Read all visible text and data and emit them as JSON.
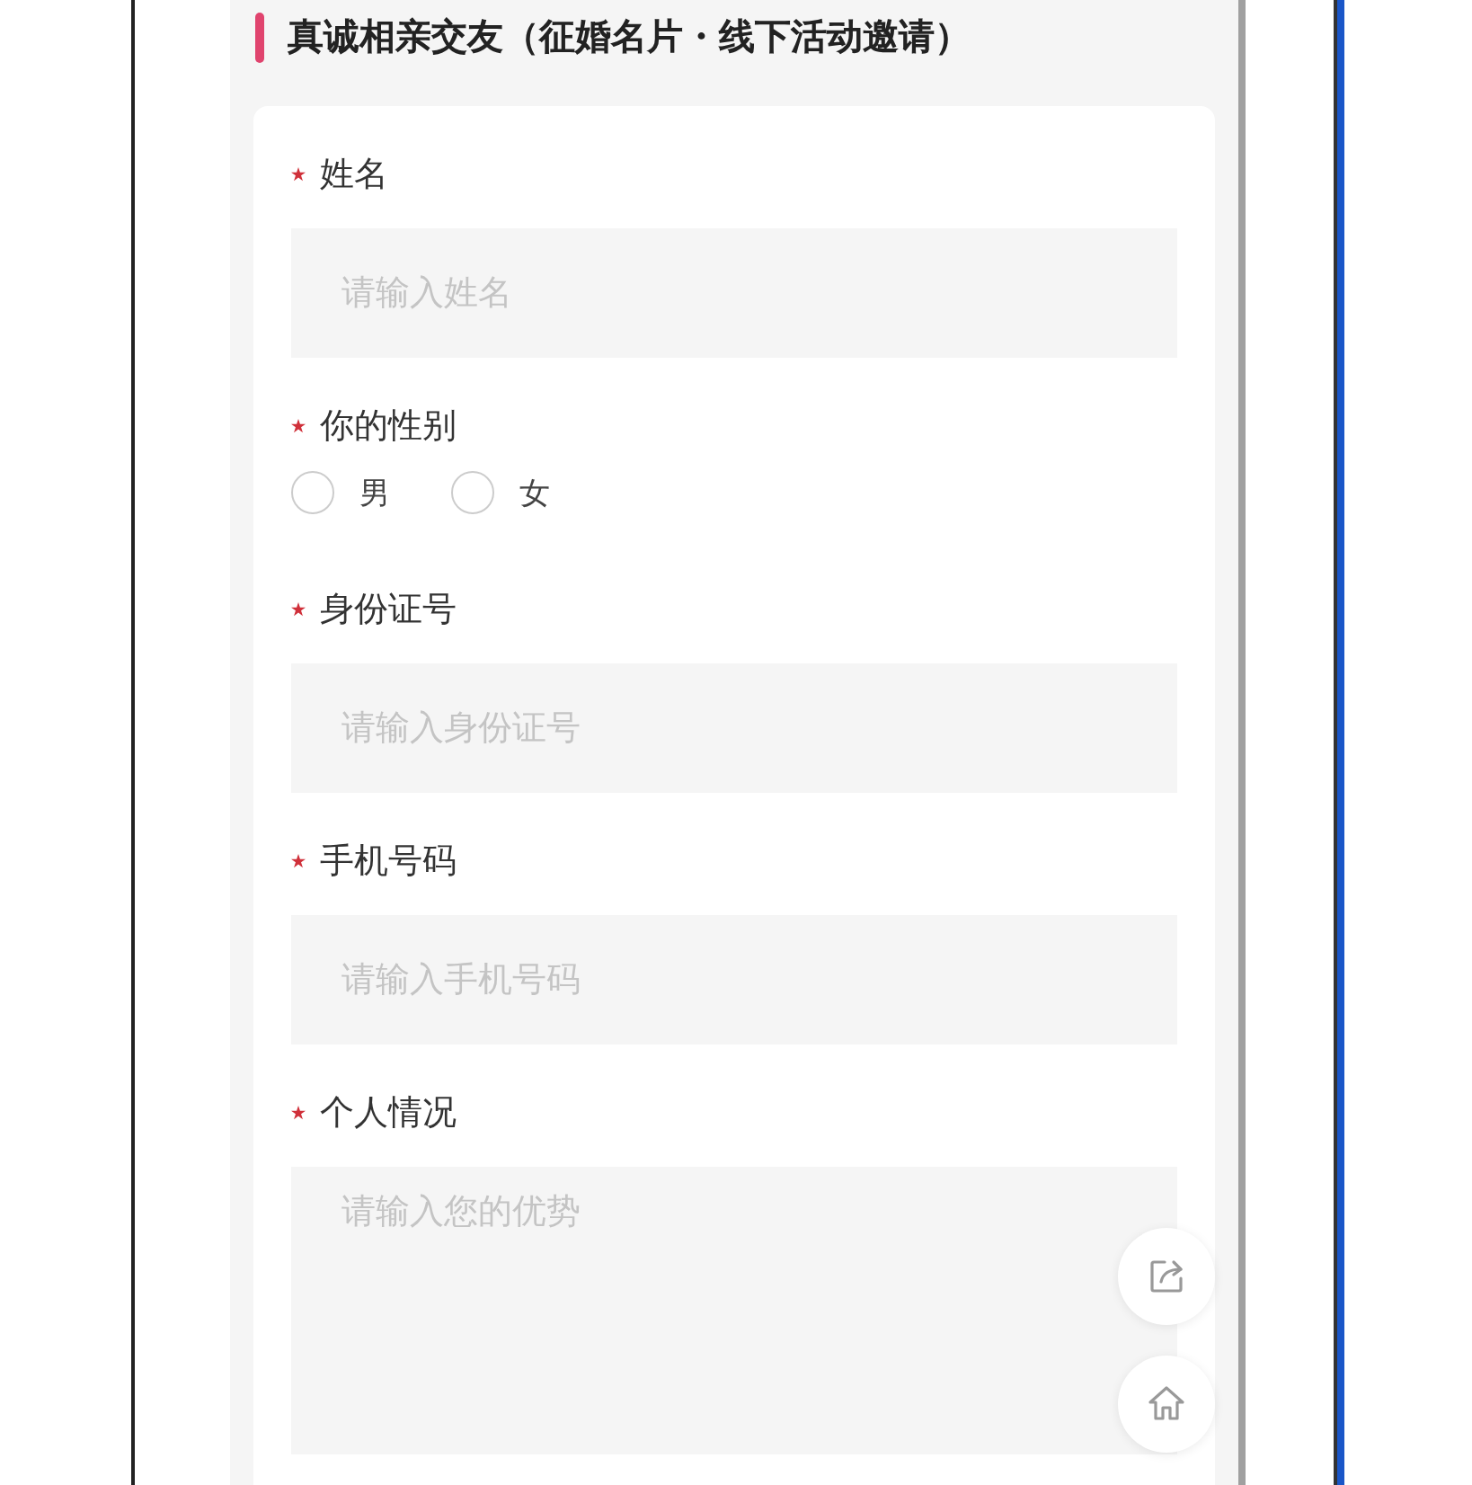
{
  "title": "真诚相亲交友（征婚名片・线下活动邀请）",
  "fields": [
    {
      "kind": "text",
      "label": "姓名",
      "required": true,
      "placeholder": "请输入姓名"
    },
    {
      "kind": "radio",
      "label": "你的性别",
      "required": true,
      "options": [
        {
          "label": "男",
          "selected": false
        },
        {
          "label": "女",
          "selected": false
        }
      ]
    },
    {
      "kind": "text",
      "label": "身份证号",
      "required": true,
      "placeholder": "请输入身份证号"
    },
    {
      "kind": "text",
      "label": "手机号码",
      "required": true,
      "placeholder": "请输入手机号码"
    },
    {
      "kind": "textarea",
      "label": "个人情况",
      "required": true,
      "placeholder": "请输入您的优势"
    }
  ]
}
